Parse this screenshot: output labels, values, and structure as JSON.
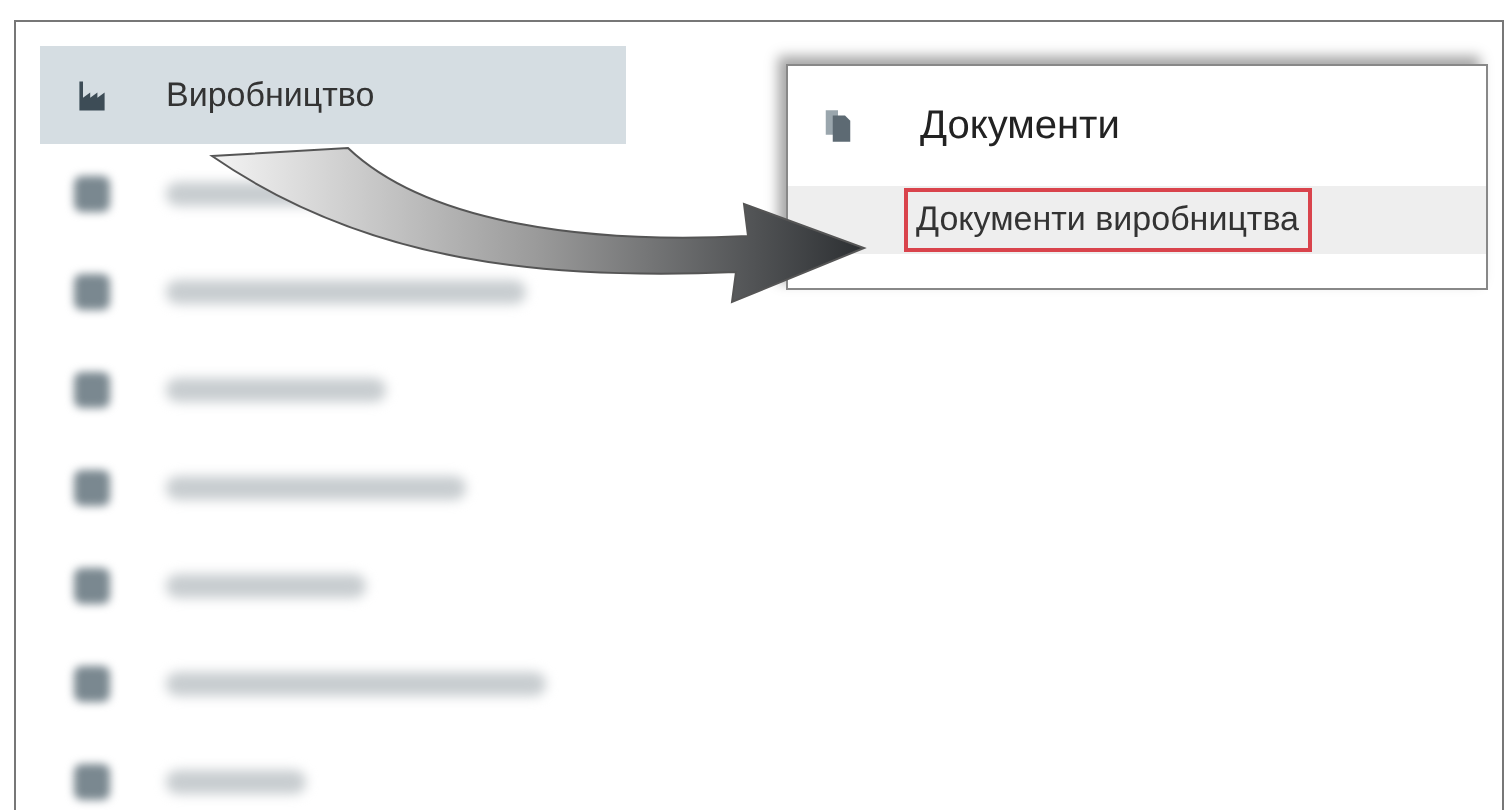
{
  "sidebar": {
    "items": [
      {
        "kind": "label",
        "label": "Виробництво",
        "selected": true
      },
      {
        "kind": "blurred",
        "selected": false
      },
      {
        "kind": "blurred",
        "selected": false
      },
      {
        "kind": "blurred",
        "selected": false
      },
      {
        "kind": "blurred",
        "selected": false
      },
      {
        "kind": "blurred",
        "selected": false
      },
      {
        "kind": "blurred",
        "selected": false
      },
      {
        "kind": "blurred",
        "selected": false
      }
    ]
  },
  "popup": {
    "title": "Документи",
    "items": [
      {
        "label": "Документи виробництва",
        "selected": true
      }
    ]
  }
}
